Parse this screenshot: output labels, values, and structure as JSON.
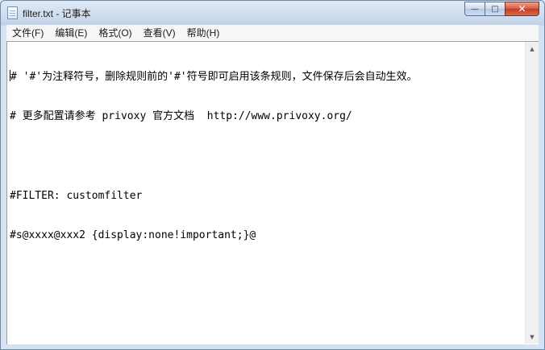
{
  "window": {
    "title": "filter.txt - 记事本",
    "buttons": {
      "minimize": "—",
      "maximize": "□",
      "close": "✕"
    }
  },
  "menu": [
    {
      "id": "file",
      "label": "文件(F)"
    },
    {
      "id": "edit",
      "label": "编辑(E)"
    },
    {
      "id": "format",
      "label": "格式(O)"
    },
    {
      "id": "view",
      "label": "查看(V)"
    },
    {
      "id": "help",
      "label": "帮助(H)"
    }
  ],
  "editor": {
    "lines": [
      "# '#'为注释符号，删除规则前的'#'符号即可启用该条规则，文件保存后会自动生效。",
      "# 更多配置请参考 privoxy 官方文档  http://www.privoxy.org/",
      "",
      "#FILTER: customfilter",
      "#s@xxxx@xxx2 {display:none!important;}@"
    ]
  },
  "scrollbar": {
    "up_arrow": "▲",
    "down_arrow": "▼"
  }
}
